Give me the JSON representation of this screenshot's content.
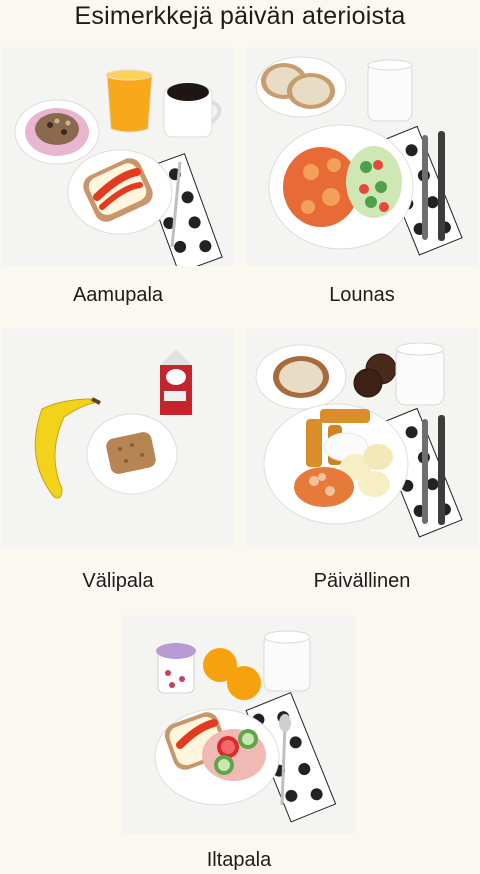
{
  "page": {
    "title": "Esimerkkejä päivän aterioista"
  },
  "meals": [
    {
      "id": "aamupala",
      "label": "Aamupala"
    },
    {
      "id": "lounas",
      "label": "Lounas"
    },
    {
      "id": "valipala",
      "label": "Välipala"
    },
    {
      "id": "paivallinen",
      "label": "Päivällinen"
    },
    {
      "id": "iltapala",
      "label": "Iltapala"
    }
  ]
}
